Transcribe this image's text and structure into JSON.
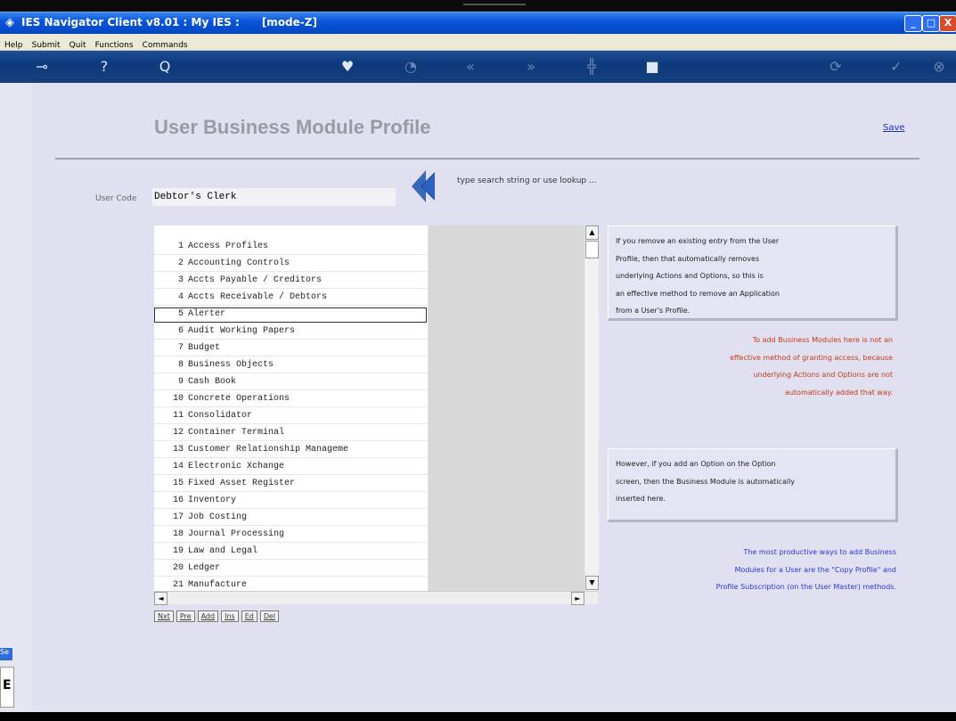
{
  "window": {
    "title": "IES Navigator Client v8.01 : My IES :      [mode-Z]",
    "controls": {
      "min": "_",
      "max": "□",
      "close": "X"
    }
  },
  "menu": [
    "Help",
    "Submit",
    "Quit",
    "Functions",
    "Commands"
  ],
  "toolbar": [
    {
      "icon": "key-icon",
      "glyph": "⊸"
    },
    {
      "icon": "help-icon",
      "glyph": "?"
    },
    {
      "icon": "search-icon",
      "glyph": "Q"
    },
    {
      "icon": "heart-icon",
      "glyph": "♥"
    },
    {
      "icon": "clock-icon",
      "glyph": "◔"
    },
    {
      "icon": "rewind-icon",
      "glyph": "«"
    },
    {
      "icon": "fast-forward-icon",
      "glyph": "»"
    },
    {
      "icon": "tree-icon",
      "glyph": "╬"
    },
    {
      "icon": "stop-icon",
      "glyph": "■"
    },
    {
      "icon": "refresh-icon",
      "glyph": "⟳"
    },
    {
      "icon": "check-icon",
      "glyph": "✓"
    },
    {
      "icon": "close-icon",
      "glyph": "⊗"
    }
  ],
  "page": {
    "title": "User Business Module Profile",
    "save_label": "Save",
    "search_hint": "type search string or use lookup ..."
  },
  "user_code": {
    "label": "User Code",
    "value": "Debtor's Clerk"
  },
  "modules": [
    {
      "num": "1",
      "name": "Access Profiles"
    },
    {
      "num": "2",
      "name": "Accounting Controls"
    },
    {
      "num": "3",
      "name": "Accts Payable / Creditors"
    },
    {
      "num": "4",
      "name": "Accts Receivable / Debtors"
    },
    {
      "num": "5",
      "name": "Alerter"
    },
    {
      "num": "6",
      "name": "Audit Working Papers"
    },
    {
      "num": "7",
      "name": "Budget"
    },
    {
      "num": "8",
      "name": "Business Objects"
    },
    {
      "num": "9",
      "name": "Cash Book"
    },
    {
      "num": "10",
      "name": "Concrete Operations"
    },
    {
      "num": "11",
      "name": "Consolidator"
    },
    {
      "num": "12",
      "name": "Container Terminal"
    },
    {
      "num": "13",
      "name": "Customer Relationship Manageme"
    },
    {
      "num": "14",
      "name": "Electronic Xchange"
    },
    {
      "num": "15",
      "name": "Fixed Asset Register"
    },
    {
      "num": "16",
      "name": "Inventory"
    },
    {
      "num": "17",
      "name": "Job Costing"
    },
    {
      "num": "18",
      "name": "Journal Processing"
    },
    {
      "num": "19",
      "name": "Law and Legal"
    },
    {
      "num": "20",
      "name": "Ledger"
    },
    {
      "num": "21",
      "name": "Manufacture"
    }
  ],
  "nav_buttons": [
    "Nxt",
    "Pre",
    "Add",
    "Ins",
    "Ed",
    "Del"
  ],
  "scroll": {
    "up": "▲",
    "down": "▼",
    "left": "◄",
    "right": "►"
  },
  "notes": {
    "box1": [
      "If you remove an existing entry from the User",
      "Profile, then that automatically removes",
      "underlying Actions and Options, so this is",
      "an effective method to remove an Application",
      "from a User's Profile."
    ],
    "red": [
      "To add Business Modules here is not an",
      "effective method of granting access, because",
      "underlying Actions and Options are not",
      "automatically added that way."
    ],
    "box2": [
      "However, if you add an Option on the Option",
      "screen, then the Business Module is automatically",
      "inserted here."
    ],
    "blue": [
      "The most productive ways to add Business",
      "Modules for a User are the \"Copy Profile\" and",
      "Profile Subscription (on the User Master) methods."
    ]
  },
  "sidebar": {
    "tab_label": "Se",
    "letter": "E"
  }
}
